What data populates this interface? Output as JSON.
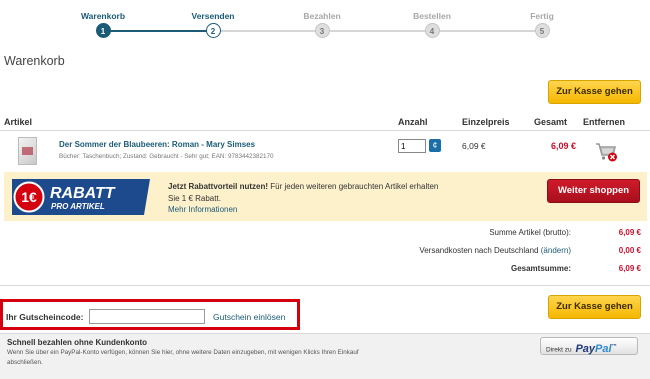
{
  "steps": [
    {
      "label": "Warenkorb",
      "num": "1"
    },
    {
      "label": "Versenden",
      "num": "2"
    },
    {
      "label": "Bezahlen",
      "num": "3"
    },
    {
      "label": "Bestellen",
      "num": "4"
    },
    {
      "label": "Fertig",
      "num": "5"
    }
  ],
  "page_title": "Warenkorb",
  "checkout_label": "Zur Kasse gehen",
  "table_headers": {
    "artikel": "Artikel",
    "anzahl": "Anzahl",
    "einzelpreis": "Einzelpreis",
    "gesamt": "Gesamt",
    "entfernen": "Entfernen"
  },
  "item": {
    "title": "Der Sommer der Blaubeeren: Roman - Mary Simses",
    "meta": "Bücher: Taschenbuch; Zustand: Gebraucht - Sehr gut; EAN: 9783442382170",
    "qty": "1",
    "qty_button": "¢",
    "unit_price": "6,09 €",
    "total": "6,09 €"
  },
  "promo": {
    "badge_amount": "1€",
    "badge_title": "RABATT",
    "badge_sub": "PRO ARTIKEL",
    "headline": "Jetzt Rabattvorteil nutzen!",
    "line1_rest": " Für jeden weiteren gebrauchten Artikel erhalten",
    "line2": "Sie 1 € Rabatt.",
    "more": "Mehr Informationen",
    "button": "Weiter shoppen"
  },
  "summary": {
    "subtotal_label": "Summe Artikel (brutto):",
    "subtotal": "6,09 €",
    "shipping_label": "Versandkosten nach Deutschland",
    "shipping_change": "(ändern)",
    "shipping": "0,00 €",
    "total_label": "Gesamtsumme:",
    "total": "6,09 €"
  },
  "voucher": {
    "label": "Ihr Gutscheincode:",
    "value": "",
    "link": "Gutschein einlösen"
  },
  "paypal": {
    "title": "Schnell bezahlen ohne Kundenkonto",
    "text": "Wenn Sie über ein PayPal-Konto verfügen, können Sie hier, ohne weitere Daten einzugeben, mit wenigen Klicks Ihren Einkauf abschließen.",
    "button_prefix": "Direkt zu",
    "logo_pay": "Pay",
    "logo_pal": "Pal",
    "logo_tm": "™"
  },
  "colors": {
    "accent_blue": "#1b5b78",
    "price_red": "#c8102e",
    "checkout_yellow": "#f5b700",
    "highlight_red": "#d4000f"
  }
}
